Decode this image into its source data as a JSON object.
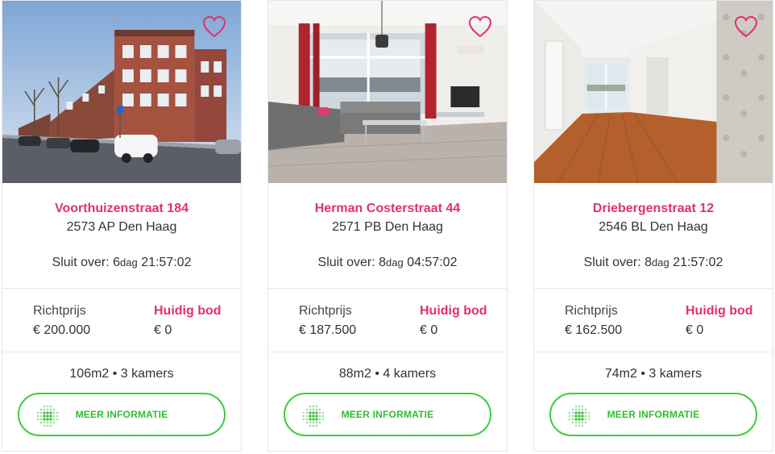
{
  "listings": [
    {
      "street": "Voorthuizenstraat 184",
      "city": "2573 AP Den Haag",
      "closing_label": "Sluit over:",
      "closing_days": "6",
      "closing_unit": "dag",
      "closing_time": "21:57:02",
      "asking_label": "Richtprijs",
      "asking_price": "€ 200.000",
      "bid_label": "Huidig bod",
      "bid_value": "€ 0",
      "specs": "106m2 • 3 kamers",
      "button_label": "MEER INFORMATIE",
      "photo": "street-with-brick-houses"
    },
    {
      "street": "Herman Costerstraat 44",
      "city": "2571 PB Den Haag",
      "closing_label": "Sluit over:",
      "closing_days": "8",
      "closing_unit": "dag",
      "closing_time": "04:57:02",
      "asking_label": "Richtprijs",
      "asking_price": "€ 187.500",
      "bid_label": "Huidig bod",
      "bid_value": "€ 0",
      "specs": "88m2 • 4 kamers",
      "button_label": "MEER INFORMATIE",
      "photo": "living-room-with-grey-sofa"
    },
    {
      "street": "Driebergenstraat 12",
      "city": "2546 BL Den Haag",
      "closing_label": "Sluit over:",
      "closing_days": "8",
      "closing_unit": "dag",
      "closing_time": "21:57:02",
      "asking_label": "Richtprijs",
      "asking_price": "€ 162.500",
      "bid_label": "Huidig bod",
      "bid_value": "€ 0",
      "specs": "74m2 • 3 kamers",
      "button_label": "MEER INFORMATIE",
      "photo": "hallway-with-wooden-floor"
    }
  ],
  "icons": {
    "favorite": "heart-outline-icon",
    "button": "dotted-circle-icon"
  },
  "colors": {
    "accent_pink": "#e3306f",
    "button_green": "#3ccc3c",
    "border": "#e6e6e6"
  }
}
